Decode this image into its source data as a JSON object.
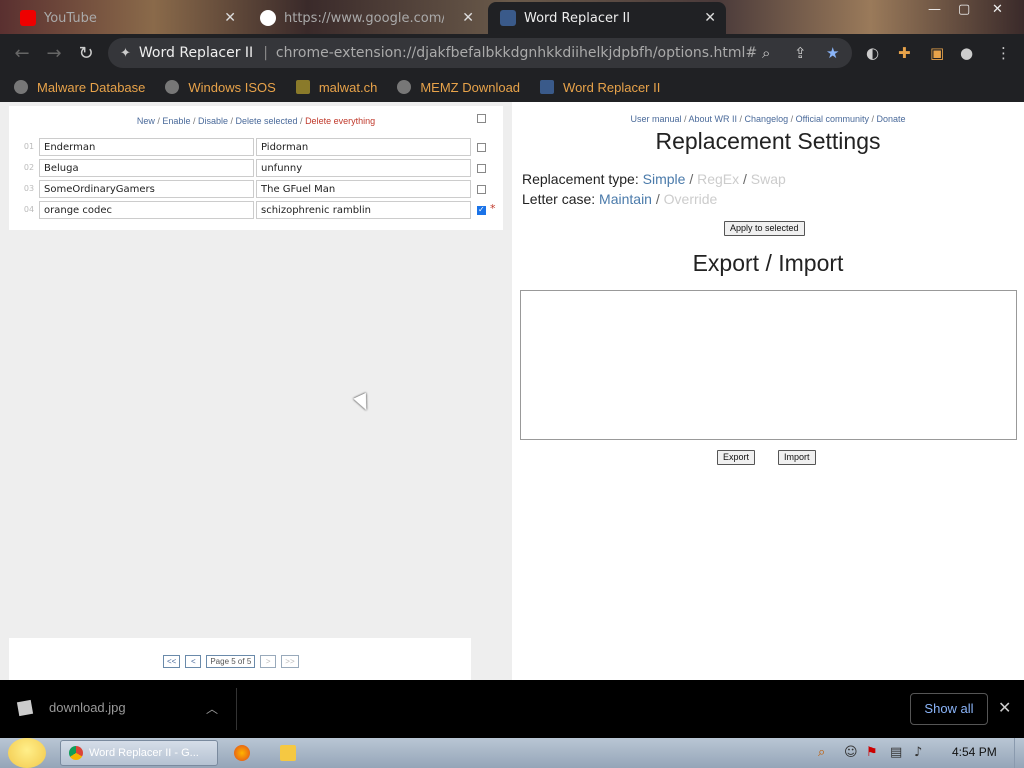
{
  "tabs": [
    {
      "title": "YouTube",
      "active": false
    },
    {
      "title": "https://www.google.com/search",
      "active": false
    },
    {
      "title": "Word Replacer II",
      "active": true
    }
  ],
  "omnibox": {
    "ext_title": "Word Replacer II",
    "separator": "|",
    "url": "chrome-extension://djakfbefalbkkdgnhkkdiihelkjdpbfh/options.html#"
  },
  "bookmarks": [
    "Malware Database",
    "Windows ISOS",
    "malwat.ch",
    "MEMZ Download",
    "Word Replacer II"
  ],
  "list": {
    "actions": {
      "new": "New",
      "enable": "Enable",
      "disable": "Disable",
      "delete_selected": "Delete selected",
      "delete_everything": "Delete everything",
      "sep": " / "
    },
    "rows": [
      {
        "num": "01",
        "find": "Enderman",
        "replace": "Pidorman",
        "checked": false
      },
      {
        "num": "02",
        "find": "Beluga",
        "replace": "unfunny",
        "checked": false
      },
      {
        "num": "03",
        "find": "SomeOrdinaryGamers",
        "replace": "The GFuel Man",
        "checked": false
      },
      {
        "num": "04",
        "find": "orange codec",
        "replace": "schizophrenic ramblin",
        "checked": true,
        "marker": "*"
      }
    ],
    "pager": {
      "first": "<<",
      "prev": "<",
      "page_label": "Page 5 of 5",
      "next": ">",
      "last": ">>"
    }
  },
  "settings": {
    "links": {
      "manual": "User manual",
      "about": "About WR II",
      "changelog": "Changelog",
      "community": "Official community",
      "donate": "Donate",
      "sep": " / "
    },
    "title": "Replacement Settings",
    "replacement_type": {
      "label": "Replacement type:",
      "options": [
        "Simple",
        "RegEx",
        "Swap"
      ],
      "active": "Simple"
    },
    "letter_case": {
      "label": "Letter case:",
      "options": [
        "Maintain",
        "Override"
      ],
      "active": "Maintain"
    },
    "apply_button": "Apply to selected",
    "export_title": "Export / Import",
    "export_button": "Export",
    "import_button": "Import"
  },
  "download_bar": {
    "file_name": "download.jpg",
    "show_all": "Show all",
    "close": "✕"
  },
  "taskbar": {
    "window_title": "Word Replacer II - G...",
    "clock": "4:54 PM"
  },
  "colors": {
    "link": "#4a6a9a",
    "danger": "#c0392b",
    "bookmark": "#e8a34a",
    "accent": "#1a73e8"
  }
}
